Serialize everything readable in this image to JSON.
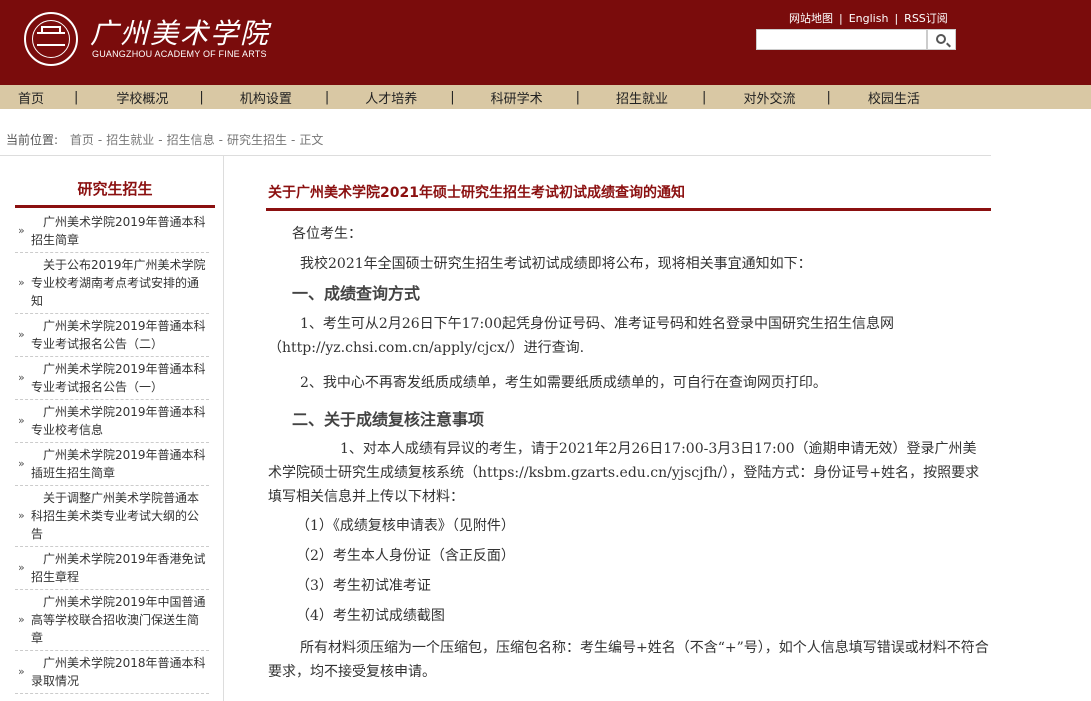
{
  "header": {
    "logo_cn": "广州美术学院",
    "logo_en": "GUANGZHOU ACADEMY OF FINE ARTS",
    "top_links": [
      "网站地图",
      "English",
      "RSS订阅"
    ],
    "search_placeholder": ""
  },
  "nav": [
    "首页",
    "学校概况",
    "机构设置",
    "人才培养",
    "科研学术",
    "招生就业",
    "对外交流",
    "校园生活"
  ],
  "breadcrumb": {
    "label": "当前位置:",
    "items": [
      "首页",
      "招生就业",
      "招生信息",
      "研究生招生",
      "正文"
    ]
  },
  "sidebar": {
    "title": "研究生招生",
    "items": [
      "广州美术学院2019年普通本科招生简章",
      "关于公布2019年广州美术学院专业校考湖南考点考试安排的通知",
      "广州美术学院2019年普通本科专业考试报名公告（二）",
      "广州美术学院2019年普通本科专业考试报名公告（一）",
      "广州美术学院2019年普通本科专业校考信息",
      "广州美术学院2019年普通本科插班生招生简章",
      "关于调整广州美术学院普通本科招生美术类专业考试大纲的公告",
      "广州美术学院2019年香港免试招生章程",
      "广州美术学院2019年中国普通高等学校联合招收澳门保送生简章",
      "广州美术学院2018年普通本科录取情况"
    ]
  },
  "article": {
    "title": "关于广州美术学院2021年硕士研究生招生考试初试成绩查询的通知",
    "p1": "各位考生：",
    "p2": "我校2021年全国硕士研究生招生考试初试成绩即将公布，现将相关事宜通知如下：",
    "h1": "一、成绩查询方式",
    "p3": "1、考生可从2月26日下午17:00起凭身份证号码、准考证号码和姓名登录中国研究生招生信息网（http://yz.chsi.com.cn/apply/cjcx/）进行查询.",
    "p4": "2、我中心不再寄发纸质成绩单，考生如需要纸质成绩单的，可自行在查询网页打印。",
    "h2": "二、关于成绩复核注意事项",
    "p5": "1、对本人成绩有异议的考生，请于2021年2月26日17:00-3月3日17:00（逾期申请无效）登录广州美术学院硕士研究生成绩复核系统（https://ksbm.gzarts.edu.cn/yjscjfh/），登陆方式：身份证号+姓名，按照要求填写相关信息并上传以下材料：",
    "l1": "（1）《成绩复核申请表》（见附件）",
    "l2": "（2）考生本人身份证（含正反面）",
    "l3": "（3）考生初试准考证",
    "l4": "（4）考生初试成绩截图",
    "p6": "所有材料须压缩为一个压缩包，压缩包名称：考生编号+姓名（不含“+”号），如个人信息填写错误或材料不符合要求，均不接受复核申请。"
  },
  "colors": {
    "brand": "#7a0c0c",
    "nav_bg": "#d9c8a4",
    "accent": "#8b1010"
  }
}
